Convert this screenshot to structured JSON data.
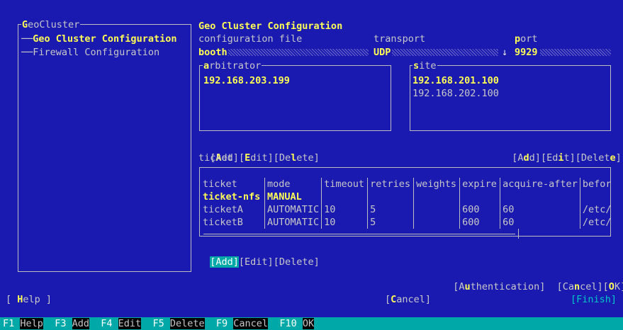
{
  "tree": {
    "root": "GeoCluster",
    "root_hot": "G",
    "root_rest": "eoCluster",
    "items": [
      {
        "label": "Geo Cluster Configuration",
        "selected": true
      },
      {
        "label": "Firewall Configuration",
        "selected": false
      }
    ]
  },
  "panel": {
    "title": "Geo Cluster Configuration",
    "col_config": "configuration file",
    "col_transport": "transport",
    "col_port_hot": "p",
    "col_port_rest": "ort",
    "config_value": "booth",
    "transport_value": "UDP",
    "dropdown_arrow": "↓",
    "port_value": "9929"
  },
  "arbitrator": {
    "legend_hot": "a",
    "legend_rest": "rbitrator",
    "items": [
      "192.168.203.199"
    ]
  },
  "site": {
    "legend_hot": "s",
    "legend_rest": "ite",
    "items": [
      "192.168.201.100",
      "192.168.202.100"
    ]
  },
  "arb_buttons": {
    "add_pre": "[",
    "add_hot": "A",
    "add_post": "dd]",
    "edit_pre": "[",
    "edit_hot": "E",
    "edit_post": "dit]",
    "delete_pre": "[De",
    "delete_hot": "l",
    "delete_post": "ete]"
  },
  "site_buttons": {
    "add_pre": "[A",
    "add_hot": "d",
    "add_post": "d]",
    "edit_pre": "[Ed",
    "edit_hot": "i",
    "edit_post": "t]",
    "delete_pre": "[Delet",
    "delete_hot": "e",
    "delete_post": "]"
  },
  "ticket": {
    "section_label": "ticket",
    "columns": [
      "ticket",
      "mode",
      "timeout",
      "retries",
      "weights",
      "expire",
      "acquire-after",
      "befor"
    ],
    "rows": [
      [
        "ticket-nfs",
        "MANUAL",
        "",
        "",
        "",
        "",
        "",
        ""
      ],
      [
        "ticketA",
        "AUTOMATIC",
        "10",
        "5",
        "",
        "600",
        "60",
        "/etc/"
      ],
      [
        "ticketB",
        "AUTOMATIC",
        "10",
        "5",
        "",
        "600",
        "60",
        "/etc/"
      ]
    ],
    "add": "[Add]",
    "edit": "[Edit]",
    "delete": "[Delete]"
  },
  "bottom_right": {
    "auth_pre": "[A",
    "auth_hot": "u",
    "auth_post": "thentication]",
    "cancel_pre": "[Ca",
    "cancel_hot": "n",
    "cancel_post": "cel]",
    "ok_pre": "[",
    "ok_hot": "O",
    "ok_post": "K]"
  },
  "footer": {
    "help_pre": "[ ",
    "help_hot": "H",
    "help_post": "elp ]",
    "cancel_pre": "[",
    "cancel_hot": "C",
    "cancel_post": "ancel]",
    "finish": "[Finish]"
  },
  "fkeys": [
    {
      "key": "F1",
      "label": "Help"
    },
    {
      "key": "F3",
      "label": "Add"
    },
    {
      "key": "F4",
      "label": "Edit"
    },
    {
      "key": "F5",
      "label": "Delete"
    },
    {
      "key": "F9",
      "label": "Cancel"
    },
    {
      "key": "F10",
      "label": "OK"
    }
  ],
  "colors": {
    "background": "#1a1ab0",
    "highlight": "#ffff55",
    "focus": "#00a8a8",
    "finish": "#00c8c8"
  }
}
